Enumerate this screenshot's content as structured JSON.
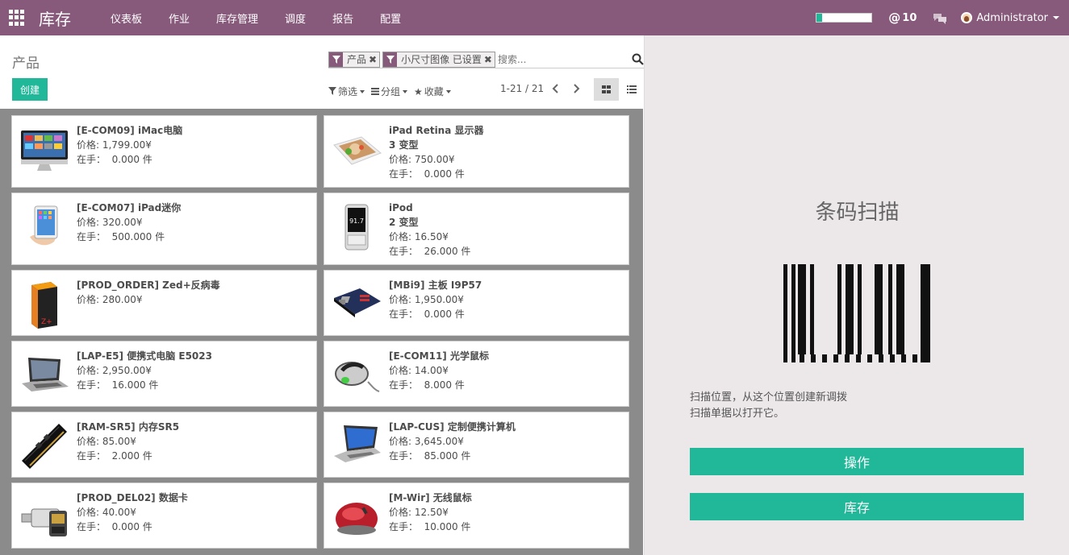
{
  "navbar": {
    "brand": "库存",
    "menu": [
      "仪表板",
      "作业",
      "库存管理",
      "调度",
      "报告",
      "配置"
    ],
    "mentions": "10",
    "user": "Administrator",
    "progress_fraction": 0.1
  },
  "control": {
    "title": "产品",
    "create_label": "创建",
    "facets": [
      "产品",
      "小尺寸图像 已设置"
    ],
    "search_placeholder": "搜索...",
    "filter_label": "筛选",
    "groupby_label": "分组",
    "favorites_label": "收藏",
    "pager": "1-21 / 21"
  },
  "products": [
    {
      "name": "[E-COM09] iMac电脑",
      "lines": [
        "价格: 1,799.00¥",
        "在手：  0.000 件"
      ],
      "image": "imac"
    },
    {
      "name": "iPad Retina 显示器",
      "lines": [
        "3 变型",
        "价格: 750.00¥",
        "在手：  0.000 件"
      ],
      "image": "ipad-retina"
    },
    {
      "name": "[E-COM07] iPad迷你",
      "lines": [
        "价格: 320.00¥",
        "在手：  500.000 件"
      ],
      "image": "ipad-mini"
    },
    {
      "name": "iPod",
      "lines": [
        "2 变型",
        "价格: 16.50¥",
        "在手：  26.000 件"
      ],
      "image": "ipod"
    },
    {
      "name": "[PROD_ORDER] Zed+反病毒",
      "lines": [
        "价格: 280.00¥"
      ],
      "image": "antivirus-box"
    },
    {
      "name": "[MBi9] 主板 I9P57",
      "lines": [
        "价格: 1,950.00¥",
        "在手：  0.000 件"
      ],
      "image": "motherboard"
    },
    {
      "name": "[LAP-E5] 便携式电脑 E5023",
      "lines": [
        "价格: 2,950.00¥",
        "在手：  16.000 件"
      ],
      "image": "laptop"
    },
    {
      "name": "[E-COM11] 光学鼠标",
      "lines": [
        "价格: 14.00¥",
        "在手：  8.000 件"
      ],
      "image": "optical-mouse"
    },
    {
      "name": "[RAM-SR5] 内存SR5",
      "lines": [
        "价格: 85.00¥",
        "在手：  2.000 件"
      ],
      "image": "ram-stick"
    },
    {
      "name": "[LAP-CUS] 定制便携计算机",
      "lines": [
        "价格: 3,645.00¥",
        "在手：  85.000 件"
      ],
      "image": "custom-laptop"
    },
    {
      "name": "[PROD_DEL02] 数据卡",
      "lines": [
        "价格: 40.00¥",
        "在手：  0.000 件"
      ],
      "image": "data-card"
    },
    {
      "name": "[M-Wir] 无线鼠标",
      "lines": [
        "价格: 12.50¥",
        "在手：  10.000 件"
      ],
      "image": "wireless-mouse"
    }
  ],
  "barcode_panel": {
    "title": "条码扫描",
    "desc_line1": "扫描位置，从这个位置创建新调拨",
    "desc_line2": "扫描单据以打开它。",
    "btn_operations": "操作",
    "btn_inventory": "库存"
  },
  "colors": {
    "navbar": "#875a7b",
    "accent": "#21b799",
    "kanban_bg": "#8b8b8b",
    "panel_bg": "#ece8ea"
  }
}
